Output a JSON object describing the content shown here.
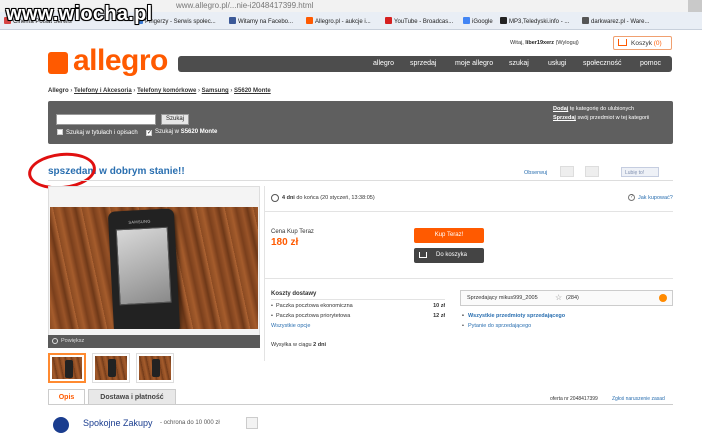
{
  "browser": {
    "url": "www.allegro.pl/...nie-i2048417399.html",
    "watermark": "www.wiocha.pl",
    "bookmarks": [
      {
        "label": "Cinéma Polsat Serwis",
        "color": "#d64545"
      },
      {
        "label": "Pingerzy - Serwis społec...",
        "color": "#3a7bd5"
      },
      {
        "label": "Witamy na Facebo...",
        "color": "#3b5998"
      },
      {
        "label": "Allegro.pl - aukcje i...",
        "color": "#ff5a00"
      },
      {
        "label": "YouTube - Broadcas...",
        "color": "#d62020"
      },
      {
        "label": "iGoogle",
        "color": "#4285f4"
      },
      {
        "label": "MP3,Teledyski.info - ...",
        "color": "#222222"
      },
      {
        "label": "darkwarez.pl - Ware...",
        "color": "#555555"
      }
    ]
  },
  "header": {
    "logo_text": "allegro",
    "user_prefix": "Witaj,",
    "user_name": "liber19xerz",
    "logout": "(Wyloguj)",
    "cart_label": "Koszyk",
    "cart_count": "(0)",
    "nav": [
      "allegro",
      "sprzedaj",
      "moje allegro",
      "szukaj",
      "usługi",
      "społeczność",
      "pomoc"
    ]
  },
  "breadcrumb": {
    "root": "Allegro",
    "items": [
      "Telefony i Akcesoria",
      "Telefony komórkowe",
      "Samsung",
      "S5620 Monte"
    ]
  },
  "search": {
    "placeholder": "",
    "button": "Szukaj",
    "opt1": "Szukaj w tytułach i opisach",
    "opt2_prefix": "Szukaj w",
    "opt2_target": "S5620 Monte",
    "hint1_link": "Dodaj",
    "hint1_text": "tę kategorię do ulubionych",
    "hint2_link": "Sprzedaj",
    "hint2_text": "swój przedmiot w tej kategorii"
  },
  "item": {
    "title": "spszedam w dobrym stanie!!",
    "observe": "Obserwuj",
    "like": "Lubię to!",
    "phone_brand": "SAMSUNG",
    "zoom": "Powiększ",
    "time_left_bold": "4 dni",
    "time_left_rest": "do końca (20 styczeń, 13:38:05)",
    "help": "Jak kupować?",
    "price_label": "Cena Kup Teraz",
    "price": "180 zł",
    "buy_now": "Kup Teraz!",
    "add_cart": "Do koszyka",
    "shipping_title": "Koszty dostawy",
    "shipping": [
      {
        "name": "Paczka pocztowa ekonomiczna",
        "price": "10 zł"
      },
      {
        "name": "Paczka pocztowa priorytetowa",
        "price": "12 zł"
      }
    ],
    "shipping_all": "Wszystkie opcje",
    "dispatch_prefix": "Wysyłka w ciągu",
    "dispatch_value": "2 dni"
  },
  "seller": {
    "label": "Sprzedający",
    "name": "mikus999_2005",
    "rating": "(284)",
    "link1": "Wszystkie przedmioty sprzedającego",
    "link2": "Pytanie do sprzedającego"
  },
  "tabs": {
    "opis": "Opis",
    "dostawa": "Dostawa i płatność",
    "offer_no": "oferta nr 2048417399",
    "report": "Zgłoś naruszenie zasad"
  },
  "safe": {
    "title": "Spokojne Zakupy",
    "subtitle": "- ochrona do 10 000 zł"
  }
}
